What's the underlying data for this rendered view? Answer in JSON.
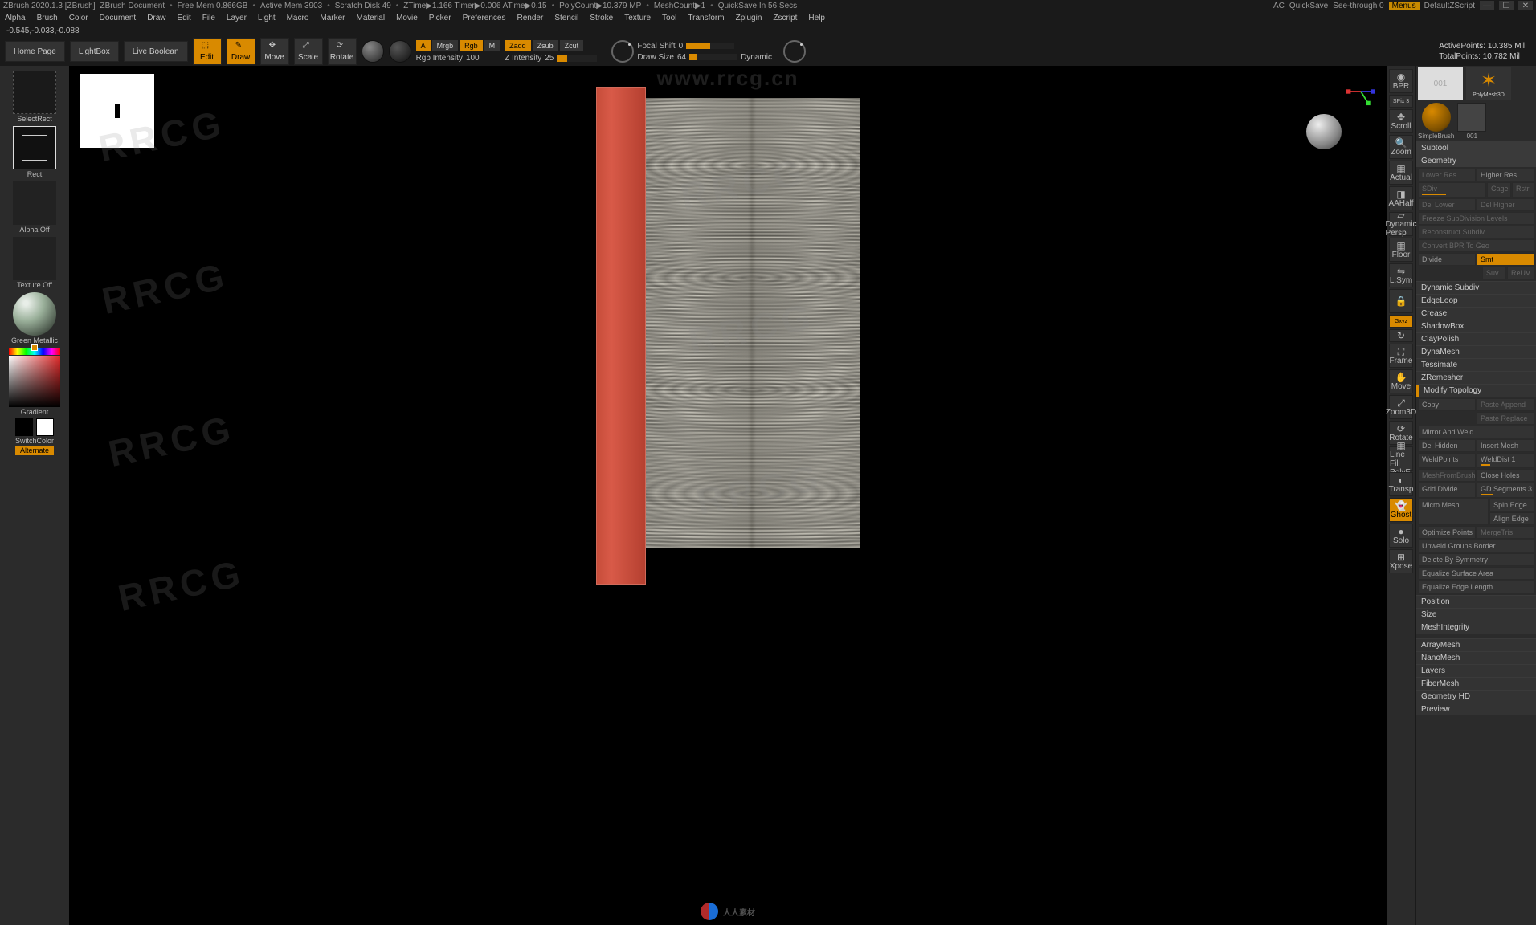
{
  "title_bar": {
    "app": "ZBrush 2020.1.3 [ZBrush]",
    "doc": "ZBrush Document",
    "free_mem": "Free Mem 0.866GB",
    "active_mem": "Active Mem 3903",
    "scratch": "Scratch Disk 49",
    "ztime": "ZTime▶1.166 Timer▶0.006 ATime▶0.15",
    "polycount": "PolyCount▶10.379 MP",
    "meshcount": "MeshCount▶1",
    "quicksave": "QuickSave In 56 Secs",
    "right": {
      "ac": "AC",
      "quicksave_btn": "QuickSave",
      "seethrough": "See-through  0",
      "menus": "Menus",
      "defaultz": "DefaultZScript"
    }
  },
  "menu": [
    "Alpha",
    "Brush",
    "Color",
    "Document",
    "Draw",
    "Edit",
    "File",
    "Layer",
    "Light",
    "Macro",
    "Marker",
    "Material",
    "Movie",
    "Picker",
    "Preferences",
    "Render",
    "Stencil",
    "Stroke",
    "Texture",
    "Tool",
    "Transform",
    "Zplugin",
    "Zscript",
    "Help"
  ],
  "coords": "-0.545,-0.033,-0.088",
  "toolbar": {
    "home": "Home Page",
    "lightbox": "LightBox",
    "liveboolean": "Live Boolean",
    "edit": "Edit",
    "draw": "Draw",
    "move": "Move",
    "scale": "Scale",
    "rotate": "Rotate",
    "modes": {
      "a": "A",
      "mrgb": "Mrgb",
      "rgb": "Rgb",
      "m": "M",
      "zadd": "Zadd",
      "zsub": "Zsub",
      "zcut": "Zcut"
    },
    "rgb_intensity": {
      "label": "Rgb Intensity",
      "value": "100"
    },
    "z_intensity": {
      "label": "Z Intensity",
      "value": "25"
    },
    "focal": {
      "label": "Focal Shift",
      "value": "0"
    },
    "drawsize": {
      "label": "Draw Size",
      "value": "64"
    },
    "dynamic": "Dynamic",
    "stats": {
      "active_label": "ActivePoints:",
      "active_val": "10.385 Mil",
      "total_label": "TotalPoints:",
      "total_val": "10.782 Mil"
    }
  },
  "left": {
    "selectrect": "SelectRect",
    "rect": "Rect",
    "alpha_off": "Alpha Off",
    "texture_off": "Texture Off",
    "material": "Green Metallic",
    "gradient": "Gradient",
    "switch": "SwitchColor",
    "alternate": "Alternate"
  },
  "right_strip": {
    "bpr": "BPR",
    "spix": "SPix 3",
    "scroll": "Scroll",
    "zoom": "Zoom",
    "actual": "Actual",
    "aahalf": "AAHalf",
    "persp": "Dynamic Persp",
    "floor": "Floor",
    "lsym": "L.Sym",
    "lock": "",
    "gxyz": "Gxyz",
    "cycle": "",
    "frame": "Frame",
    "move": "Move",
    "zoom3d": "Zoom3D",
    "rotate": "Rotate",
    "polyf": "Line Fill PolyF",
    "transp": "Transp",
    "ghost": "Ghost",
    "solo": "Solo",
    "xpose": "Xpose"
  },
  "tool_panel": {
    "thumb1_count": "001",
    "thumb2": "PolyMesh3D",
    "simplebrush": "SimpleBrush",
    "brush_count": "001",
    "subtool": "Subtool",
    "geometry": "Geometry",
    "geo": {
      "lower_res": "Lower Res",
      "higher_res": "Higher Res",
      "sdiv": "SDiv",
      "cage": "Cage",
      "rstr": "Rstr",
      "del_lower": "Del Lower",
      "del_higher": "Del Higher",
      "freeze": "Freeze SubDivision Levels",
      "reconstruct": "Reconstruct Subdiv",
      "convert": "Convert BPR To Geo",
      "divide": "Divide",
      "smt": "Smt",
      "suv": "Suv",
      "reuv": "ReUV"
    },
    "sections": [
      "Dynamic Subdiv",
      "EdgeLoop",
      "Crease",
      "ShadowBox",
      "ClayPolish",
      "DynaMesh",
      "Tessimate",
      "ZRemesher"
    ],
    "modify": "Modify Topology",
    "mt": {
      "copy": "Copy",
      "paste_append": "Paste Append",
      "paste_replace": "Paste Replace",
      "mirror": "Mirror And Weld",
      "del_hidden": "Del Hidden",
      "insert_mesh": "Insert Mesh",
      "weldpoints": "WeldPoints",
      "welddist": "WeldDist 1",
      "meshfrombrush": "MeshFromBrush",
      "close_holes": "Close Holes",
      "grid_divide": "Grid Divide",
      "gd_segments": "GD Segments 3",
      "micro_mesh": "Micro Mesh",
      "spin_edge": "Spin Edge",
      "align_edge": "Align Edge",
      "optimize": "Optimize Points",
      "mergetris": "MergeTris",
      "unweld": "Unweld Groups Border",
      "del_sym": "Delete By Symmetry",
      "eq_surface": "Equalize Surface Area",
      "eq_edge": "Equalize Edge Length",
      "position": "Position",
      "size": "Size",
      "meshintegrity": "MeshIntegrity"
    },
    "bottom": [
      "ArrayMesh",
      "NanoMesh",
      "Layers",
      "FiberMesh",
      "Geometry HD",
      "Preview"
    ]
  },
  "watermarks": {
    "rrcg": "RRCG",
    "url": "www.rrcg.cn",
    "footer": "人人素材"
  }
}
